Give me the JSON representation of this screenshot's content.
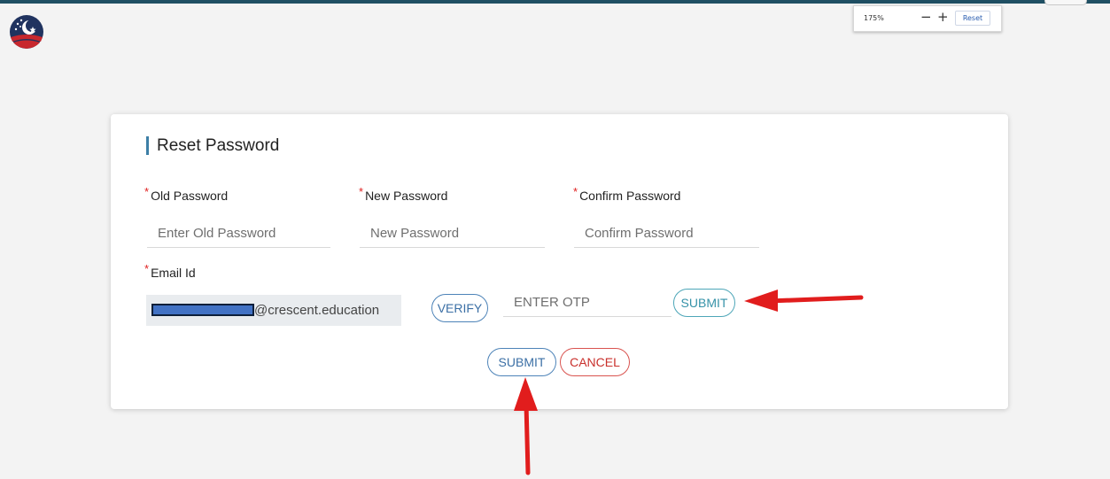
{
  "zoom": {
    "level": "175%",
    "minus": "−",
    "plus": "+",
    "reset": "Reset"
  },
  "form": {
    "title": "Reset Password",
    "required_mark": "*",
    "old_password": {
      "label": "Old Password",
      "placeholder": "Enter Old Password"
    },
    "new_password": {
      "label": "New Password",
      "placeholder": "New Password"
    },
    "confirm_password": {
      "label": "Confirm Password",
      "placeholder": "Confirm Password"
    },
    "email": {
      "label": "Email Id",
      "domain_suffix": "@crescent.education"
    },
    "verify_label": "VERIFY",
    "otp_placeholder": "ENTER OTP",
    "otp_submit_label": "SUBMIT",
    "submit_label": "SUBMIT",
    "cancel_label": "CANCEL"
  },
  "colors": {
    "accent": "#3d7fa6",
    "required": "#e02020",
    "arrow": "#e11d1d",
    "topbar": "#1f4f63"
  }
}
